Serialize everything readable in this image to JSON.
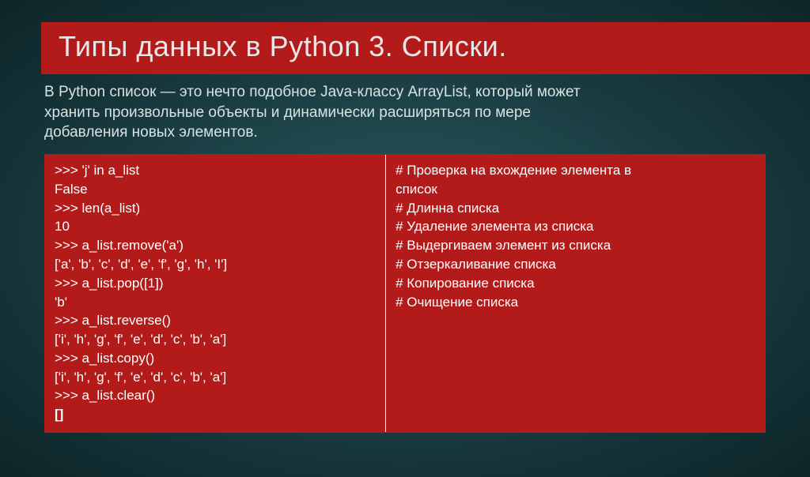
{
  "title": "Типы данных в Python 3. Списки.",
  "subtitle": "В Python список — это нечто подобное Java-классу ArrayList, который может хранить произвольные объекты и динамически расширяться по мере добавления новых элементов.",
  "code_left": [
    ">>> 'j' in a_list",
    "False",
    ">>> len(a_list)",
    "10",
    ">>> a_list.remove('a')",
    "['a', 'b', 'c', 'd', 'e', 'f', 'g', 'h', 'I']",
    ">>> a_list.pop([1])",
    "'b'",
    ">>> a_list.reverse()",
    "['i', 'h', 'g', 'f', 'e', 'd', 'c', 'b', 'a']",
    ">>> a_list.copy()",
    "['i', 'h', 'g', 'f', 'e', 'd', 'c', 'b', 'a']",
    ">>> a_list.clear()"
  ],
  "code_left_last": "[]",
  "code_right": [
    "# Проверка на вхождение элемента в",
    "список",
    "# Длинна списка",
    "",
    "# Удаление элемента из списка",
    "",
    "# Выдергиваем элемент из списка",
    "",
    "# Отзеркаливание списка",
    "",
    "# Копирование списка",
    "",
    "# Очищение списка"
  ]
}
